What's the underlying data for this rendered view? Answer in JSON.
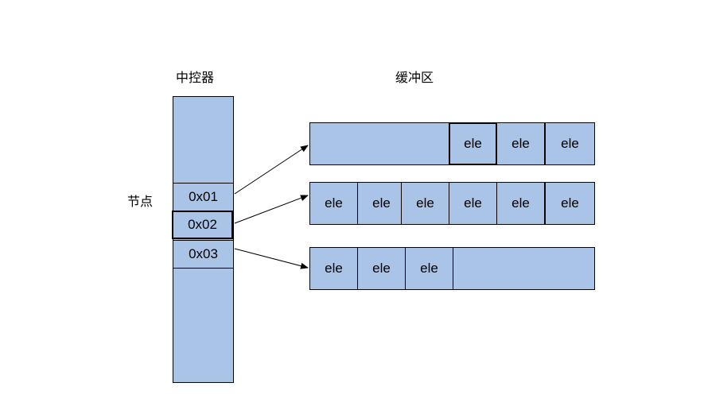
{
  "labels": {
    "controller_title": "中控器",
    "buffer_title": "缓冲区",
    "node_label": "节点"
  },
  "nodes": [
    {
      "label": "0x01"
    },
    {
      "label": "0x02"
    },
    {
      "label": "0x03"
    }
  ],
  "buffers": [
    {
      "elements": [
        "ele",
        "ele",
        "ele"
      ]
    },
    {
      "elements": [
        "ele",
        "ele",
        "ele",
        "ele",
        "ele",
        "ele"
      ]
    },
    {
      "elements": [
        "ele",
        "ele",
        "ele"
      ]
    }
  ],
  "colors": {
    "fill": "#a9c4e6",
    "stroke": "#000000"
  }
}
